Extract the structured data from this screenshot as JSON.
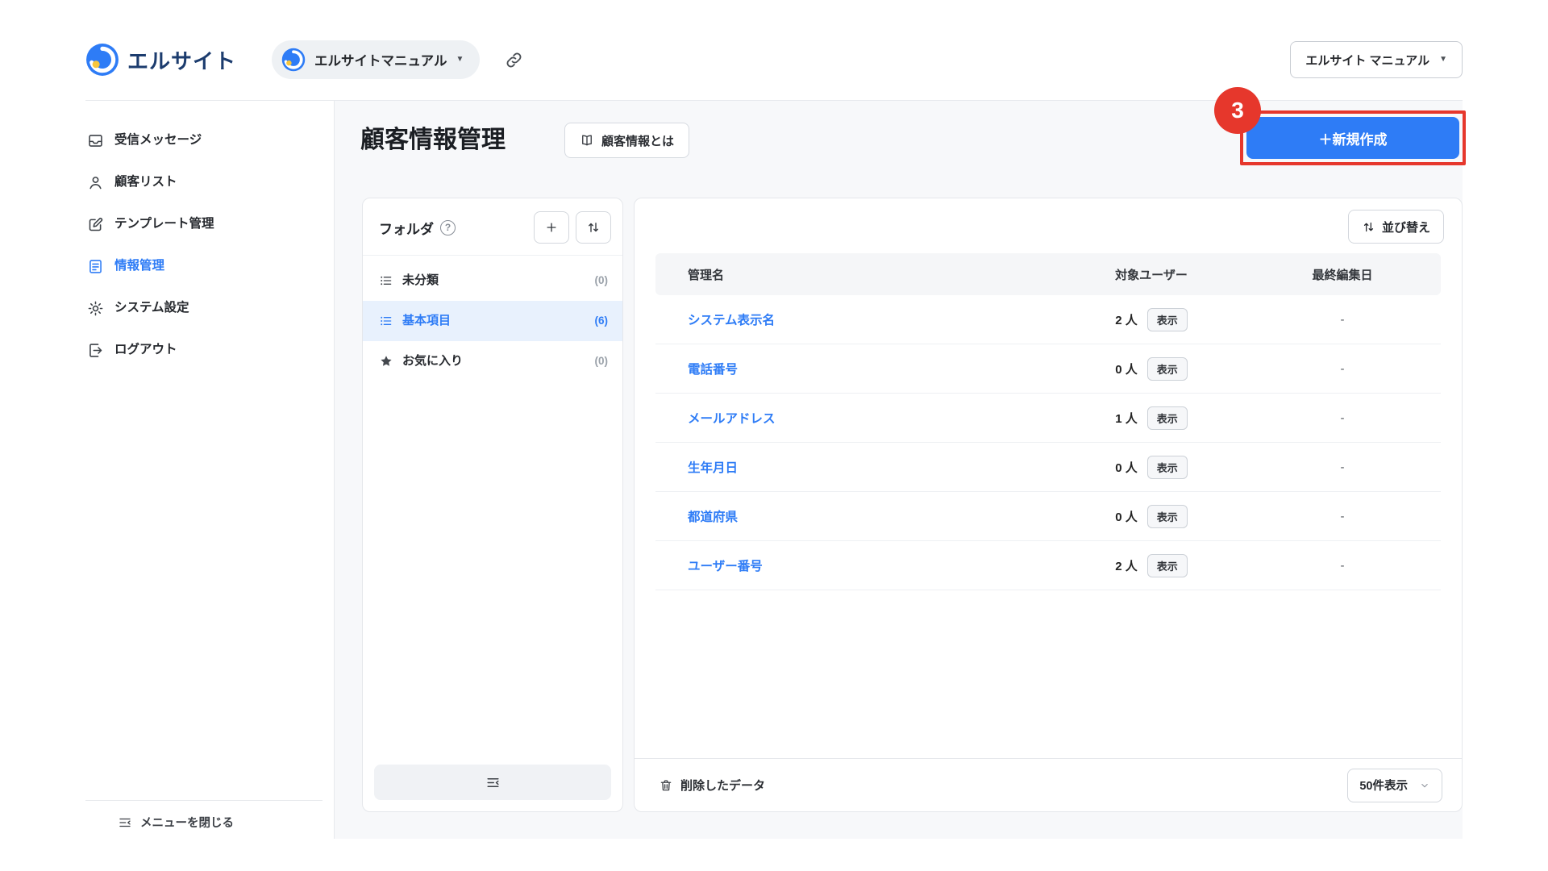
{
  "header": {
    "logo_text": "エルサイト",
    "account_name": "エルサイトマニュアル",
    "manual_button_label": "エルサイト マニュアル"
  },
  "sidebar": {
    "items": [
      {
        "label": "受信メッセージ",
        "icon": "inbox-icon",
        "active": false
      },
      {
        "label": "顧客リスト",
        "icon": "person-icon",
        "active": false
      },
      {
        "label": "テンプレート管理",
        "icon": "template-icon",
        "active": false
      },
      {
        "label": "情報管理",
        "icon": "document-icon",
        "active": true
      },
      {
        "label": "システム設定",
        "icon": "gear-icon",
        "active": false
      },
      {
        "label": "ログアウト",
        "icon": "logout-icon",
        "active": false
      }
    ],
    "close_menu_label": "メニューを閉じる"
  },
  "main": {
    "page_title": "顧客情報管理",
    "info_button_label": "顧客情報とは",
    "create_button_label": "＋新規作成",
    "annotation_badge": "3",
    "folders": {
      "title": "フォルダ",
      "items": [
        {
          "label": "未分類",
          "count": "(0)",
          "icon": "list-icon",
          "active": false
        },
        {
          "label": "基本項目",
          "count": "(6)",
          "icon": "list-icon",
          "active": true
        },
        {
          "label": "お気に入り",
          "count": "(0)",
          "icon": "star-icon",
          "active": false
        }
      ]
    },
    "table": {
      "sort_button_label": "並び替え",
      "columns": [
        "管理名",
        "対象ユーザー",
        "最終編集日"
      ],
      "rows": [
        {
          "name": "システム表示名",
          "user_count": "2 人",
          "show_label": "表示",
          "last_edited": "-"
        },
        {
          "name": "電話番号",
          "user_count": "0 人",
          "show_label": "表示",
          "last_edited": "-"
        },
        {
          "name": "メールアドレス",
          "user_count": "1 人",
          "show_label": "表示",
          "last_edited": "-"
        },
        {
          "name": "生年月日",
          "user_count": "0 人",
          "show_label": "表示",
          "last_edited": "-"
        },
        {
          "name": "都道府県",
          "user_count": "0 人",
          "show_label": "表示",
          "last_edited": "-"
        },
        {
          "name": "ユーザー番号",
          "user_count": "2 人",
          "show_label": "表示",
          "last_edited": "-"
        }
      ],
      "deleted_data_label": "削除したデータ",
      "page_size_label": "50件表示"
    },
    "colors": {
      "accent_blue": "#2e7cf6",
      "highlight_red": "#e6372c",
      "selected_bg": "#e8f1fd",
      "logo_navy": "#1c3c6e",
      "logo_yellow": "#f8c63d"
    }
  }
}
